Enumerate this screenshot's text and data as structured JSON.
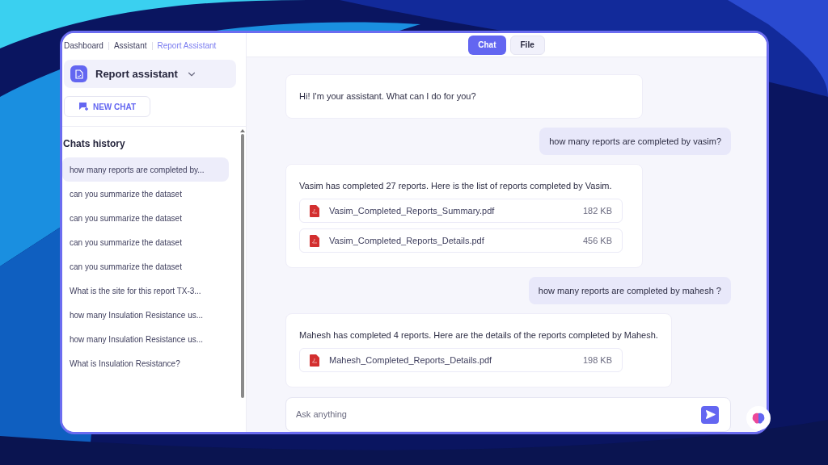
{
  "breadcrumb": [
    {
      "label": "Dashboard",
      "selected": false
    },
    {
      "label": "Assistant",
      "selected": false
    },
    {
      "label": "Report Assistant",
      "selected": true
    }
  ],
  "assistant_selector": {
    "label": "Report assistant"
  },
  "new_chat_button": {
    "label": "NEW CHAT"
  },
  "chats_history": {
    "title": "Chats history",
    "items": [
      {
        "label": "how many reports are completed by...",
        "selected": true
      },
      {
        "label": "can you summarize the dataset",
        "selected": false
      },
      {
        "label": "can you summarize the dataset",
        "selected": false
      },
      {
        "label": "can you summarize the dataset",
        "selected": false
      },
      {
        "label": "can you summarize the dataset",
        "selected": false
      },
      {
        "label": "What is the site for this report TX-3...",
        "selected": false
      },
      {
        "label": "how many Insulation Resistance us...",
        "selected": false
      },
      {
        "label": "how many Insulation Resistance us...",
        "selected": false
      },
      {
        "label": "What is Insulation Resistance?",
        "selected": false
      }
    ]
  },
  "tabs": [
    {
      "label": "Chat",
      "selected": true
    },
    {
      "label": "File",
      "selected": false
    }
  ],
  "messages": [
    {
      "kind": "bot",
      "text": "Hi! I'm your assistant. What can I do for you?"
    },
    {
      "kind": "user",
      "text": "how many reports are completed by vasim?"
    },
    {
      "kind": "bot",
      "text": "Vasim has completed 27 reports. Here is the list of reports completed by Vasim.",
      "files": [
        {
          "name": "Vasim_Completed_Reports_Summary.pdf",
          "size": "182 KB"
        },
        {
          "name": "Vasim_Completed_Reports_Details.pdf",
          "size": "456 KB"
        }
      ]
    },
    {
      "kind": "user",
      "text": "how many reports are completed by mahesh ?"
    },
    {
      "kind": "bot",
      "text": "Mahesh has completed 4 reports. Here are the details of the reports completed by Mahesh.",
      "files": [
        {
          "name": "Mahesh_Completed_Reports_Details.pdf",
          "size": "198 KB"
        }
      ]
    }
  ],
  "composer": {
    "placeholder": "Ask anything"
  }
}
